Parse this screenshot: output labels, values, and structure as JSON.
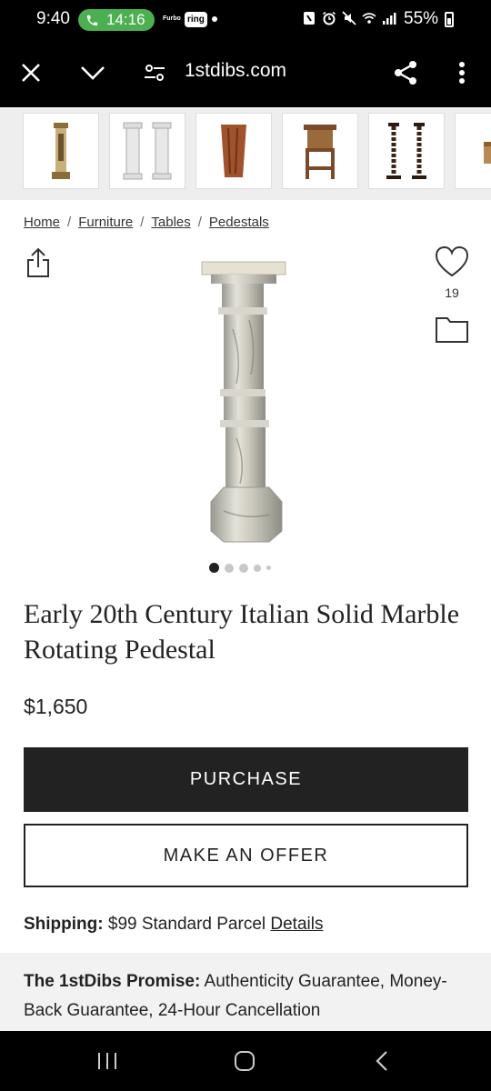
{
  "status_bar": {
    "time": "9:40",
    "call_timer": "14:16",
    "furbo_label": "Furbo",
    "ring_label": "ring",
    "battery": "55%"
  },
  "browser": {
    "url": "1stdibs.com"
  },
  "breadcrumb": {
    "items": [
      "Home",
      "Furniture",
      "Tables",
      "Pedestals"
    ],
    "separator": "/"
  },
  "favorites": {
    "count": "19"
  },
  "carousel": {
    "active_index": 0,
    "total_dots": 5
  },
  "product": {
    "title": "Early 20th Century Italian Solid Marble Rotating Pedestal",
    "price": "$1,650"
  },
  "actions": {
    "purchase_label": "PURCHASE",
    "offer_label": "MAKE AN OFFER"
  },
  "shipping": {
    "label": "Shipping:",
    "value": "$99 Standard Parcel",
    "details_link": "Details"
  },
  "promise": {
    "label": "The 1stDibs Promise:",
    "text": "Authenticity Guarantee, Money-Back Guarantee, 24-Hour Cancellation"
  },
  "colors": {
    "call_green": "#4caf50",
    "button_dark": "#222222",
    "promise_bg": "#f2f2f2"
  }
}
